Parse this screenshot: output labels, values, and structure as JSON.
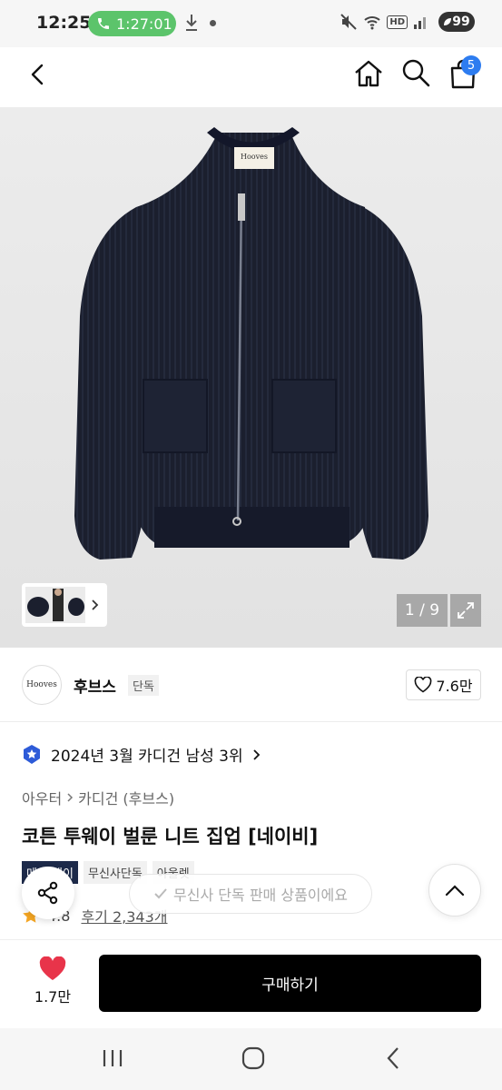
{
  "status_bar": {
    "time": "12:25",
    "call_timer": "1:27:01",
    "hd_label": "HD",
    "battery": "99"
  },
  "header": {
    "cart_count": "5"
  },
  "gallery": {
    "image_brand_label": "Hooves",
    "page_counter": "1 / 9"
  },
  "brand": {
    "logo_text": "Hooves",
    "name": "후브스",
    "tag": "단독",
    "like_count": "7.6만"
  },
  "ranking": {
    "text": "2024년 3월 카디건 남성 3위"
  },
  "breadcrumb": {
    "level1": "아우터",
    "level2": "카디건 (후브스)"
  },
  "product": {
    "title": "코튼 투웨이 벌룬 니트 집업 [네이비]",
    "tags": [
      "메가 데이",
      "무신사단독",
      "아울렛"
    ],
    "rating": "4.8",
    "review_link": "후기 2,343개"
  },
  "toast": {
    "text": "무신사 단독 판매 상품이에요"
  },
  "bottom_bar": {
    "like_count": "1.7만",
    "buy_label": "구매하기"
  },
  "colors": {
    "accent_blue": "#2d7cf0",
    "call_green": "#5cc46b",
    "heart_red": "#e8344a",
    "tag_navy": "#1d2a4a",
    "star_gold": "#f5a623"
  }
}
